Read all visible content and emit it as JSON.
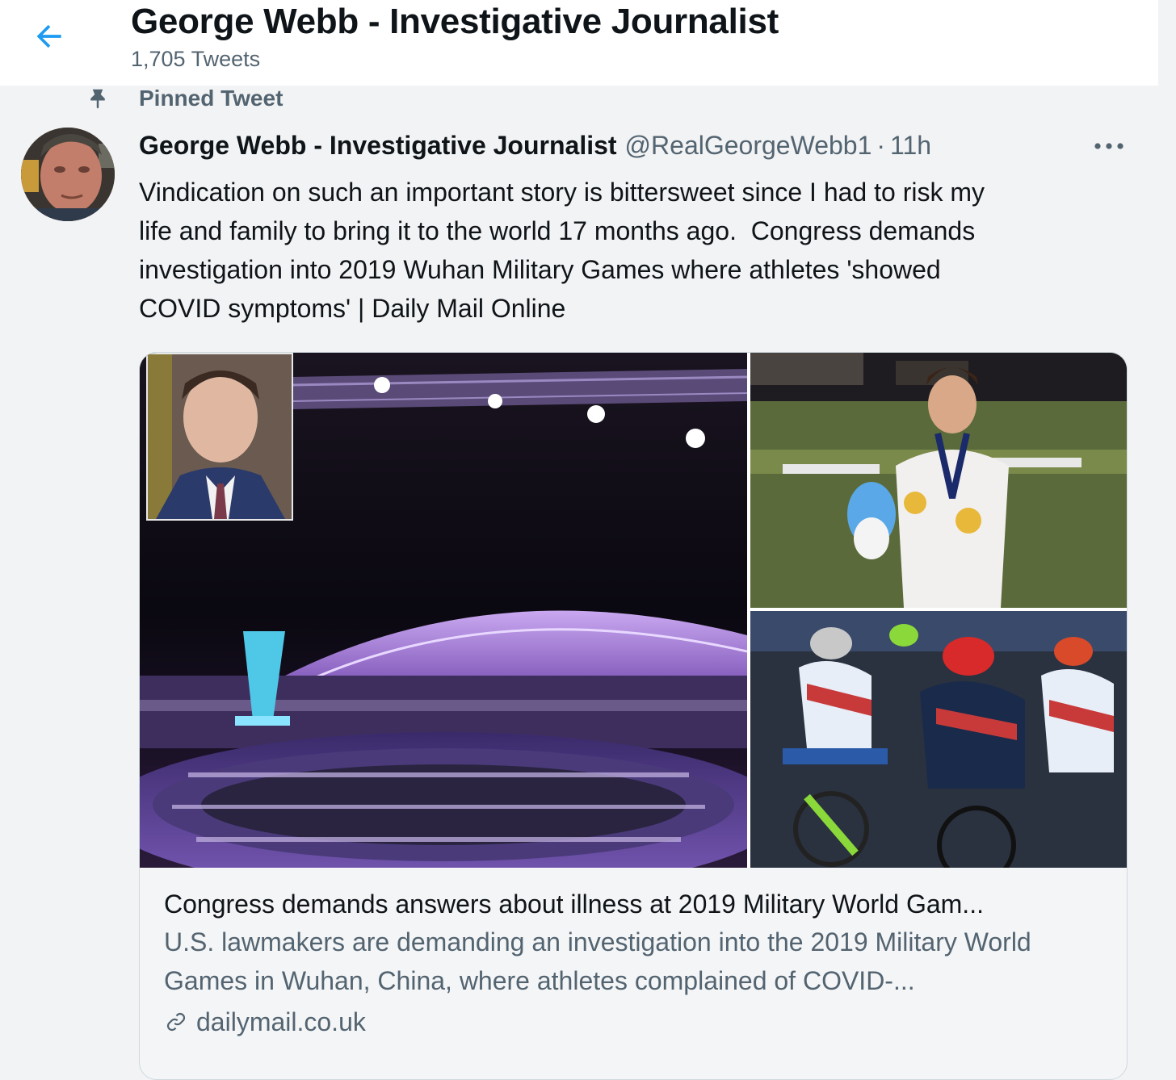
{
  "header": {
    "back_icon": "arrow-left-icon",
    "title": "George Webb - Investigative Journalist",
    "tweet_count": "1,705 Tweets"
  },
  "pinned": {
    "icon": "pin-icon",
    "label": "Pinned Tweet"
  },
  "tweet": {
    "author_name": "George Webb - Investigative Journalist",
    "handle": "@RealGeorgeWebb1",
    "separator": "·",
    "time": "11h",
    "more_icon": "more-horizontal-icon",
    "text": "Vindication on such an important story is bittersweet since I had to risk my\nlife and family to bring it to the world 17 months ago.  Congress demands\ninvestigation into 2019 Wuhan Military Games where athletes 'showed\nCOVID symptoms' | Daily Mail Online"
  },
  "card": {
    "title": "Congress demands answers about illness at 2019 Military World Gam...",
    "description": "U.S. lawmakers are demanding an investigation into the 2019 Military World Games in Wuhan, China, where athletes complained of COVID-...",
    "link_icon": "link-icon",
    "domain": "dailymail.co.uk"
  },
  "colors": {
    "accent": "#1d9bf0",
    "secondary_text": "#536471",
    "background": "#f2f3f4"
  }
}
